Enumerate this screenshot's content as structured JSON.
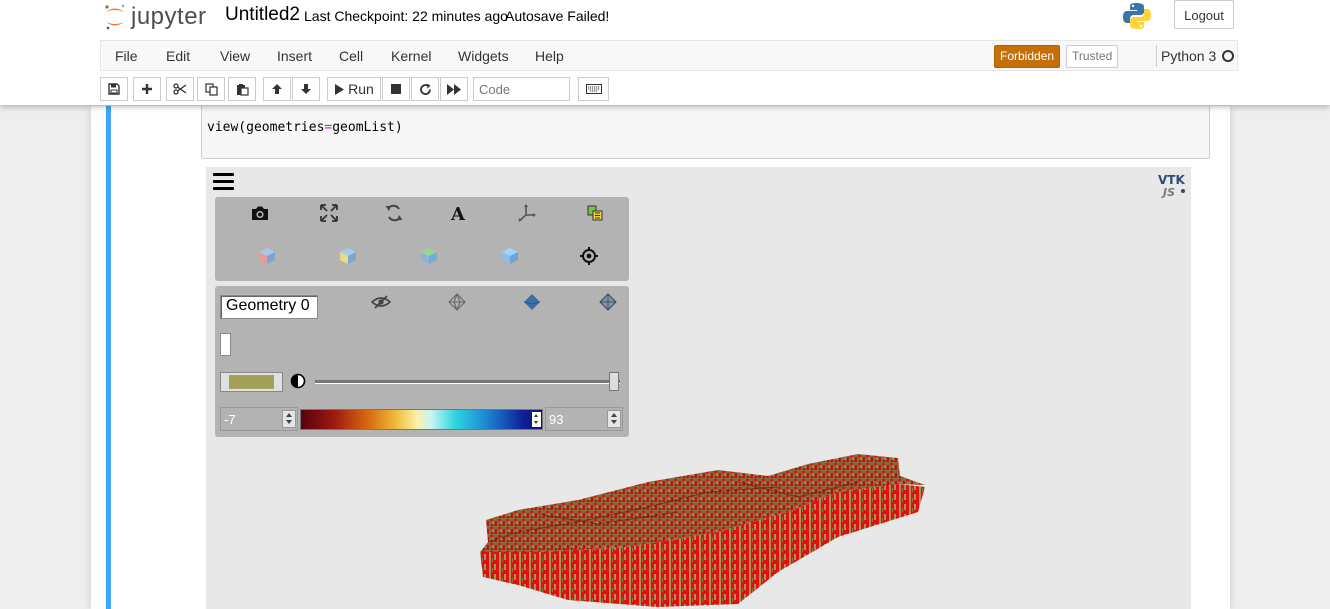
{
  "app": {
    "logo_text": "jupyter",
    "notebook_name": "Untitled2",
    "checkpoint": "Last Checkpoint: 22 minutes ago",
    "autosave": "Autosave Failed!",
    "logout_label": "Logout"
  },
  "menu": {
    "items": [
      "File",
      "Edit",
      "View",
      "Insert",
      "Cell",
      "Kernel",
      "Widgets",
      "Help"
    ],
    "forbidden_label": "Forbidden",
    "trusted_label": "Trusted",
    "kernel_name": "Python 3"
  },
  "toolbar": {
    "run_label": "Run",
    "cell_type_placeholder": "Code",
    "icons": [
      "save-icon",
      "plus-icon",
      "cut-icon",
      "copy-icon",
      "paste-icon",
      "arrow-up-icon",
      "arrow-down-icon",
      "play-icon",
      "stop-icon",
      "restart-icon",
      "fast-forward-icon",
      "keyboard-icon"
    ]
  },
  "cell": {
    "code_prefix": "view(geometries",
    "code_op": "=",
    "code_suffix": "geomList)"
  },
  "vtk": {
    "geometry_name": "Geometry 0",
    "range_min": "-7",
    "range_max": "93",
    "opacity_fraction": 0.98,
    "geometry_color": "#a3a05a",
    "colormap_colors": [
      "#5a0010",
      "#d86a10",
      "#fbf0a8",
      "#30d4e0",
      "#101070"
    ],
    "logo": "VTK JS",
    "toolbar_icons": [
      "camera-icon",
      "fullscreen-icon",
      "rotate-icon",
      "font-icon",
      "axes-icon",
      "color-legend-icon"
    ],
    "view_icons": [
      "cube-view-x-icon",
      "cube-view-y-icon",
      "cube-view-z-icon",
      "cube-view-iso-icon",
      "center-target-icon"
    ],
    "representation_icons": [
      "visibility-off-icon",
      "wireframe-icon",
      "surface-icon",
      "surface-edges-icon"
    ]
  }
}
